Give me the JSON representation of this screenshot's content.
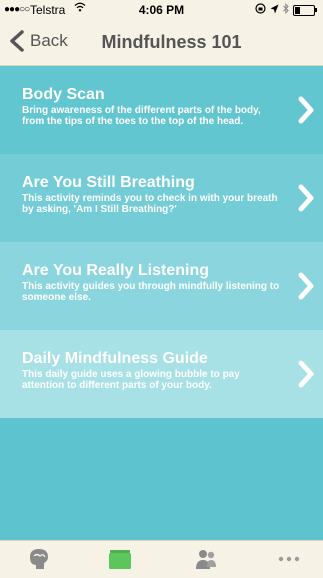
{
  "status_bar": {
    "signal": "●●●○○",
    "carrier": "Telstra",
    "time": "4:06 PM",
    "wifi_icon": "wifi-icon",
    "right_icons": [
      "lock-rotation-icon",
      "location-arrow-icon",
      "bluetooth-icon",
      "battery-icon"
    ]
  },
  "nav": {
    "back_label": "Back",
    "title": "Mindfulness 101"
  },
  "items": [
    {
      "title": "Body Scan",
      "description": "Bring awareness of the different parts of the body, from the tips of the toes to the top of the head."
    },
    {
      "title": "Are You Still Breathing",
      "description": "This activity reminds you to check in with your breath by asking, 'Am I Still Breathing?'"
    },
    {
      "title": "Are You Really Listening",
      "description": "This activity guides you through mindfully listening to someone else."
    },
    {
      "title": "Daily Mindfulness Guide",
      "description": "This daily guide uses a glowing bubble to pay attention to different parts of your body."
    }
  ],
  "tabs": [
    {
      "icon": "brain-head-icon"
    },
    {
      "icon": "folder-icon",
      "active_color": "#5cc65c"
    },
    {
      "icon": "people-icon"
    },
    {
      "icon": "more-dots-icon"
    }
  ],
  "colors": {
    "accent": "#5dc4cf",
    "bar_background": "#f6f2e6"
  }
}
